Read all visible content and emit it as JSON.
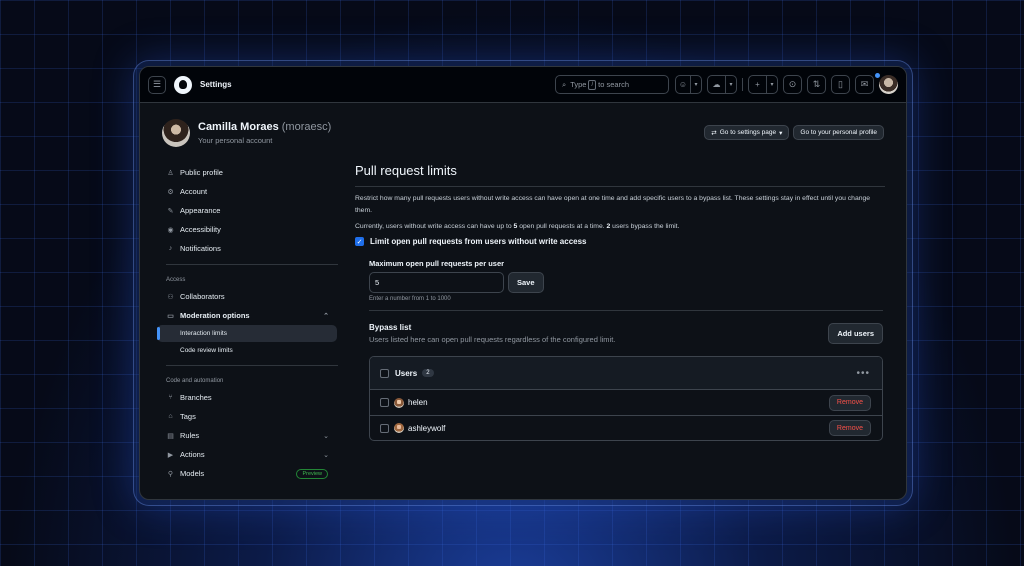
{
  "header": {
    "title": "Settings",
    "search_prefix": "Type",
    "search_key": "/",
    "search_suffix": "to search"
  },
  "profile": {
    "name": "Camilla Moraes",
    "handle": "(moraesc)",
    "subtitle": "Your personal account",
    "settings_page_label": "Go to settings page",
    "personal_profile_label": "Go to your personal profile"
  },
  "sidebar": {
    "items": [
      {
        "label": "Public profile",
        "icon": "person-icon"
      },
      {
        "label": "Account",
        "icon": "gear-icon"
      },
      {
        "label": "Appearance",
        "icon": "paintbrush-icon"
      },
      {
        "label": "Accessibility",
        "icon": "accessibility-icon"
      },
      {
        "label": "Notifications",
        "icon": "bell-icon"
      }
    ],
    "access_heading": "Access",
    "access_items": [
      {
        "label": "Collaborators",
        "icon": "people-icon"
      },
      {
        "label": "Moderation options",
        "icon": "comment-icon"
      }
    ],
    "moderation_sub": [
      "Interaction limits",
      "Code review limits"
    ],
    "code_heading": "Code and automation",
    "code_items": [
      {
        "label": "Branches",
        "icon": "branch-icon"
      },
      {
        "label": "Tags",
        "icon": "tag-icon"
      },
      {
        "label": "Rules",
        "icon": "rules-icon"
      },
      {
        "label": "Actions",
        "icon": "play-icon"
      },
      {
        "label": "Models",
        "icon": "models-icon"
      }
    ],
    "preview_badge": "Preview"
  },
  "main": {
    "title": "Pull request limits",
    "description": "Restrict how many pull requests users without write access can have open at one time and add specific users to a bypass list. These settings stay in effect until you change them.",
    "summary_part1": "Currently, users without write access can have up to",
    "summary_count": "5",
    "summary_part2": "open pull requests at a time.",
    "summary_bypass": "2",
    "summary_part3": "users bypass the limit.",
    "limit_checkbox_label": "Limit open pull requests from users without write access",
    "limit_enabled": true,
    "max_label": "Maximum open pull requests per user",
    "max_value": "5",
    "save_label": "Save",
    "max_hint": "Enter a number from 1 to 1000",
    "bypass_title": "Bypass list",
    "bypass_desc": "Users listed here can open pull requests regardless of the configured limit.",
    "add_users_label": "Add users",
    "users_header": "Users",
    "users_count": "2",
    "users": [
      {
        "name": "helen",
        "remove_label": "Remove"
      },
      {
        "name": "ashleywolf",
        "remove_label": "Remove"
      }
    ]
  },
  "colors": {
    "accent": "#1f6feb",
    "danger": "#f85149",
    "success": "#3fb950"
  }
}
